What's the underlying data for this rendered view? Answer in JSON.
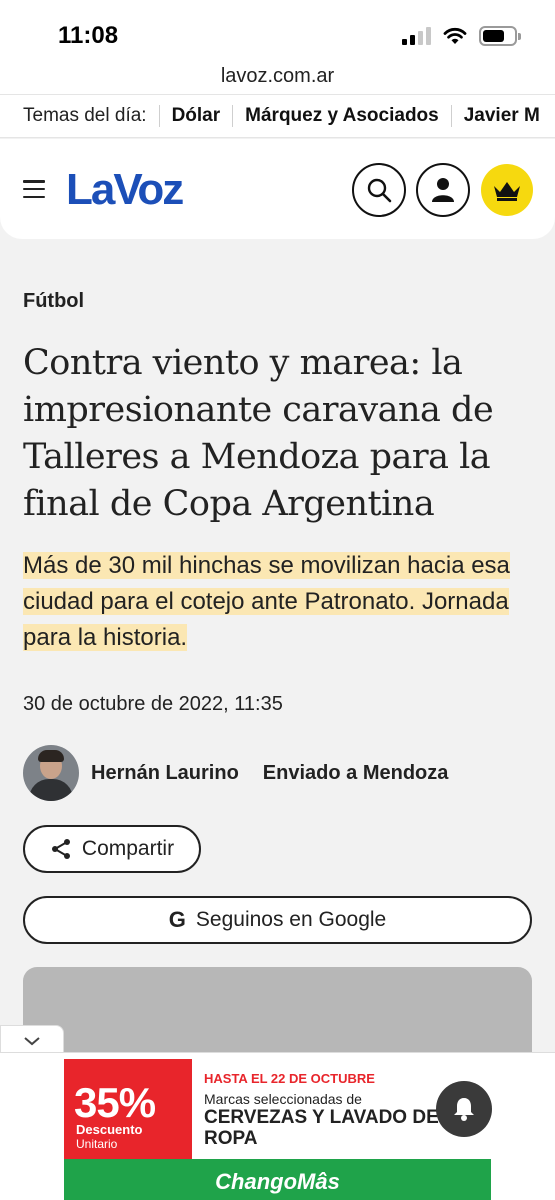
{
  "status_bar": {
    "time": "11:08"
  },
  "browser": {
    "url": "lavoz.com.ar"
  },
  "temas": {
    "label": "Temas del día:",
    "items": [
      "Dólar",
      "Márquez y Asociados",
      "Javier M"
    ]
  },
  "header": {
    "logo": "LaVoz"
  },
  "article": {
    "category": "Fútbol",
    "headline": "Contra viento y marea: la impresionante caravana de Talleres a Mendoza para la final de Copa Argentina",
    "subhead": "Más de 30 mil hinchas se movilizan hacia esa ciudad para el cotejo ante Patronato. Jornada para la historia.",
    "date": "30 de octubre de 2022, 11:35",
    "author_name": "Hernán Laurino",
    "author_role": "Enviado a Mendoza",
    "share_label": "Compartir",
    "google_label": "Seguinos en Google"
  },
  "ad": {
    "percent": "35%",
    "discount_label": "Descuento",
    "unit_label": "Unitario",
    "date_line": "HASTA EL 22 DE OCTUBRE",
    "line1": "Marcas seleccionadas de",
    "line2": "CERVEZAS Y LAVADO DE ROPA",
    "brand": "ChangoMâs"
  },
  "colors": {
    "brand_blue": "#1c4fb8",
    "crown_yellow": "#f6d90f",
    "highlight": "#fbe7b3",
    "ad_red": "#e8252b",
    "ad_green": "#1fa34a"
  }
}
